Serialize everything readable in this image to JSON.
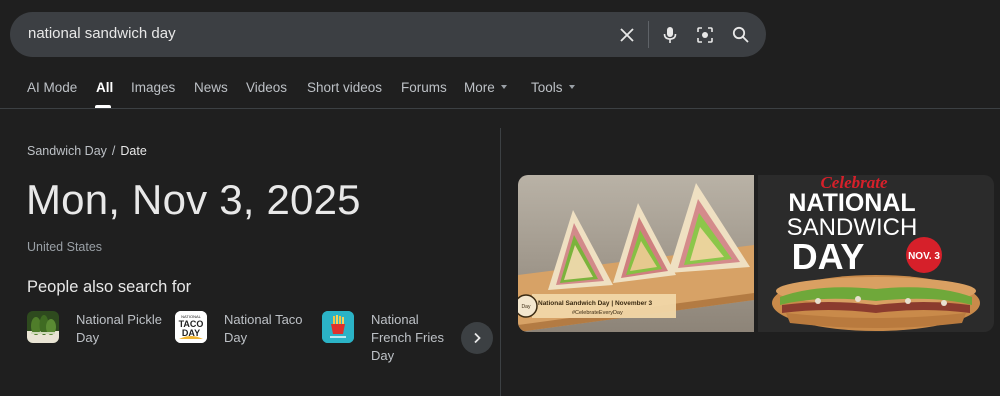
{
  "search": {
    "query": "national sandwich day"
  },
  "tabs": [
    {
      "label": "AI Mode"
    },
    {
      "label": "All"
    },
    {
      "label": "Images"
    },
    {
      "label": "News"
    },
    {
      "label": "Videos"
    },
    {
      "label": "Short videos"
    },
    {
      "label": "Forums"
    },
    {
      "label": "More"
    },
    {
      "label": "Tools"
    }
  ],
  "breadcrumb": {
    "parent": "Sandwich Day",
    "separator": "/",
    "current": "Date"
  },
  "answer": {
    "date": "Mon, Nov 3, 2025",
    "region": "United States"
  },
  "people_also_search": {
    "title": "People also search for",
    "items": [
      {
        "label": "National Pickle Day",
        "icon": "pickle-thumbnail"
      },
      {
        "label": "National Taco Day",
        "icon": "taco-day-logo",
        "logo_text": [
          "NATIONAL",
          "TACO",
          "DAY"
        ]
      },
      {
        "label": "National French Fries Day",
        "icon": "french-fries-thumbnail"
      }
    ]
  },
  "images": [
    {
      "caption": "National Sandwich Day | November 3",
      "hashtag": "#CelebrateEveryDay",
      "badge": "Day"
    },
    {
      "script": "Celebrate",
      "line1": "NATIONAL",
      "line2": "SANDWICH",
      "line3": "DAY",
      "badge": "NOV. 3"
    }
  ],
  "colors": {
    "background": "#1f1f1f",
    "searchbar": "#3c3f43",
    "accent_red": "#d6202a"
  }
}
